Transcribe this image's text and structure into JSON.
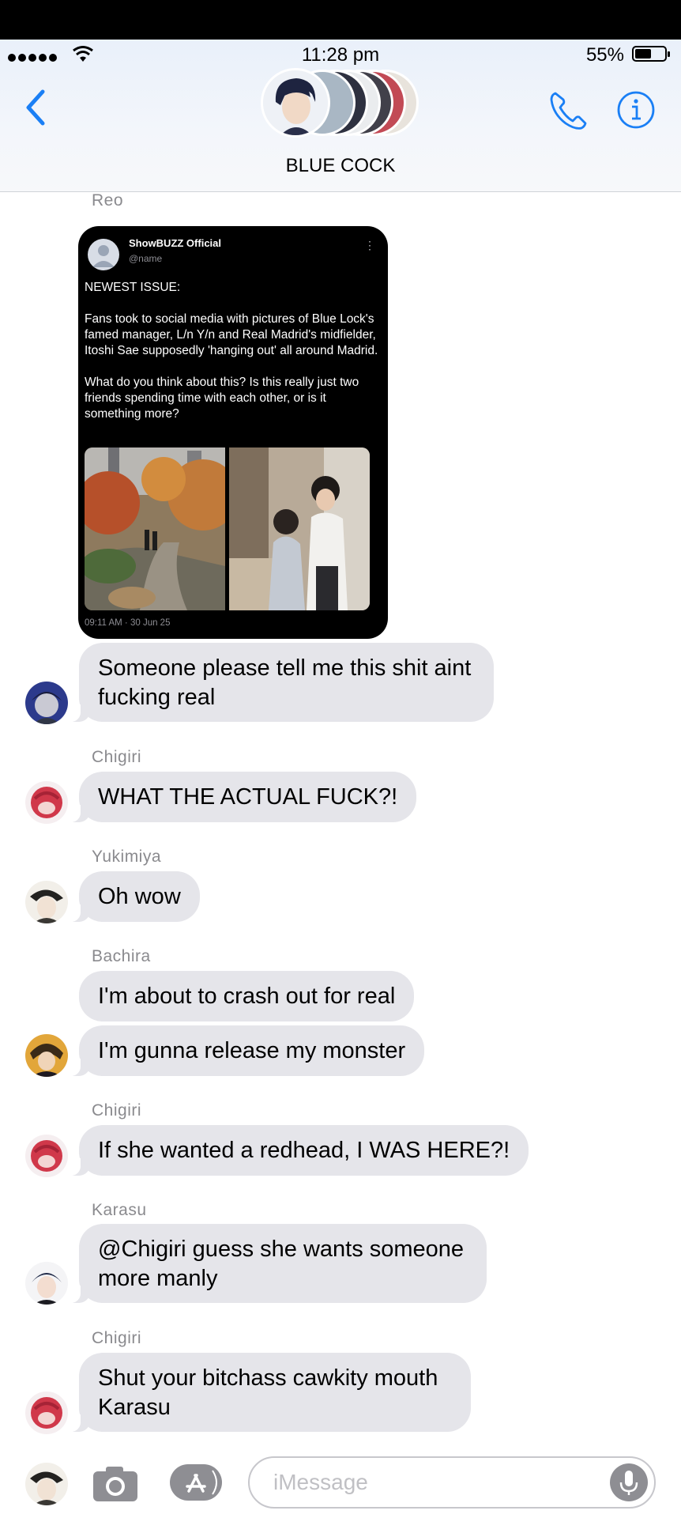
{
  "status_bar": {
    "time": "11:28 pm",
    "battery": "55%",
    "battery_level": 0.55
  },
  "header": {
    "group_name": "BLUE COCK"
  },
  "post": {
    "sender": "Reo",
    "account": "ShowBUZZ Official",
    "handle": "@name",
    "text": "NEWEST ISSUE:\n\nFans took to social media with pictures of Blue Lock's famed manager, L/n Y/n and Real Madrid's midfielder, Itoshi Sae supposedly 'hanging out' all around Madrid.\n\nWhat do you think about this? Is this really just two friends spending time with each other, or is it something more?",
    "timestamp": "09:11 AM · 30 Jun 25"
  },
  "messages": [
    {
      "sender": "",
      "text": "Someone please tell me this shit aint fucking real"
    },
    {
      "sender": "Chigiri",
      "text": "WHAT THE ACTUAL FUCK?!"
    },
    {
      "sender": "Yukimiya",
      "text": "Oh wow"
    },
    {
      "sender": "Bachira",
      "text": "I'm about to crash out for real"
    },
    {
      "sender": "",
      "text": "I'm gunna release my monster"
    },
    {
      "sender": "Chigiri",
      "text": "If she wanted a redhead, I WAS HERE?!"
    },
    {
      "sender": "Karasu",
      "text": "@Chigiri guess she wants someone more manly"
    },
    {
      "sender": "Chigiri",
      "text": "Shut your bitchass cawkity mouth Karasu"
    }
  ],
  "composer": {
    "placeholder": "iMessage"
  },
  "icons": {
    "back": "chevron-left-icon",
    "phone": "phone-icon",
    "info": "info-icon",
    "camera": "camera-icon",
    "apps": "app-store-icon",
    "mic": "microphone-icon"
  },
  "colors": {
    "accent": "#1a7ff5",
    "bubble": "#e5e5ea",
    "sender": "#8a8a8e"
  }
}
